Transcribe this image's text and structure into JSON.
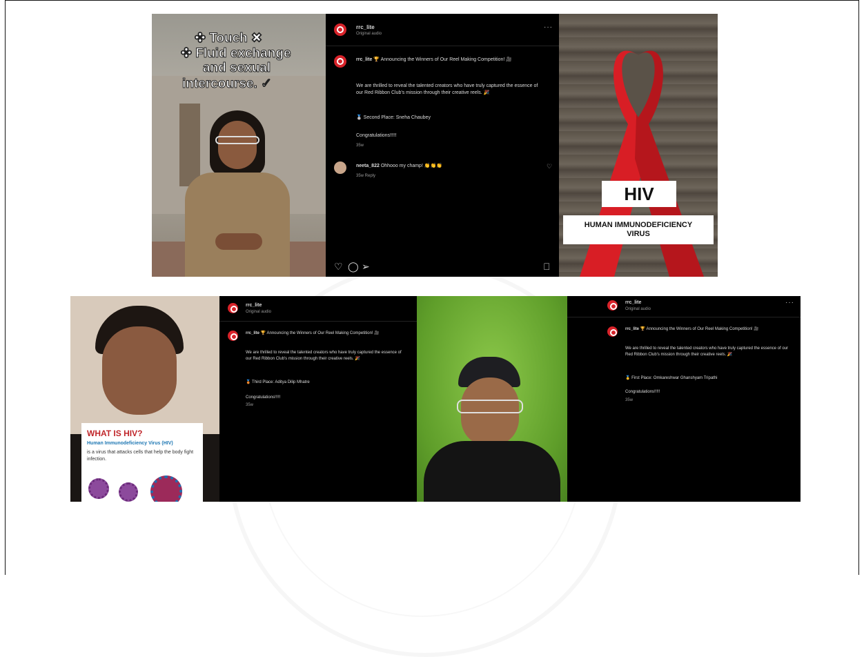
{
  "wm": {
    "text": ""
  },
  "top_left": {
    "overlay_line1": "✤ Touch ✖",
    "overlay_line2": "✤ Fluid exchange",
    "overlay_line3": "and sexual",
    "overlay_line4": "intercourse. ✓"
  },
  "post1": {
    "username": "rrc_lite",
    "audio": "Original audio",
    "caption_user": "rrc_lite",
    "caption_title": "🏆 Announcing the Winners of Our Reel Making Competition! 🎥",
    "caption_body": "We are thrilled to reveal the talented creators who have truly captured the essence of our Red Ribbon Club's mission through their creative reels. 🎉",
    "winner": "🥈 Second Place: Sneha Chaubey",
    "congrats": "Congratulations!!!!!",
    "time": "35w",
    "comment_user": "neeta_822",
    "comment_text": "Ohhooo my champ! 👏👏👏",
    "comment_meta": "35w  Reply"
  },
  "hiv_poster": {
    "title": "HIV",
    "subtitle": "HUMAN IMMUNODEFICIENCY VIRUS"
  },
  "bottom_left": {
    "heading": "WHAT IS HIV?",
    "line1": "Human Immunodeficiency Virus (HIV)",
    "line2": "is a virus that attacks cells that help the body fight infection."
  },
  "post2": {
    "username": "rrc_lite",
    "audio": "Original audio",
    "caption_user": "rrc_lite",
    "caption_title": "🏆 Announcing the Winners of Our Reel Making Competition! 🎥",
    "caption_body": "We are thrilled to reveal the talented creators who have truly captured the essence of our Red Ribbon Club's mission through their creative reels. 🎉",
    "winner": "🥉 Third Place: Aditya Dilip Mhatre",
    "congrats": "Congratulations!!!!!",
    "time": "35w"
  },
  "post3": {
    "username": "rrc_lite",
    "audio": "Original audio",
    "caption_user": "rrc_lite",
    "caption_title": "🏆 Announcing the Winners of Our Reel Making Competition! 🎥",
    "caption_body": "We are thrilled to reveal the talented creators who have truly captured the essence of our Red Ribbon Club's mission through their creative reels. 🎉",
    "winner": "🥇 First Place: Omkareshwar Ghanshyam Tripathi",
    "congrats": "Congratulations!!!!!",
    "time": "35w"
  }
}
